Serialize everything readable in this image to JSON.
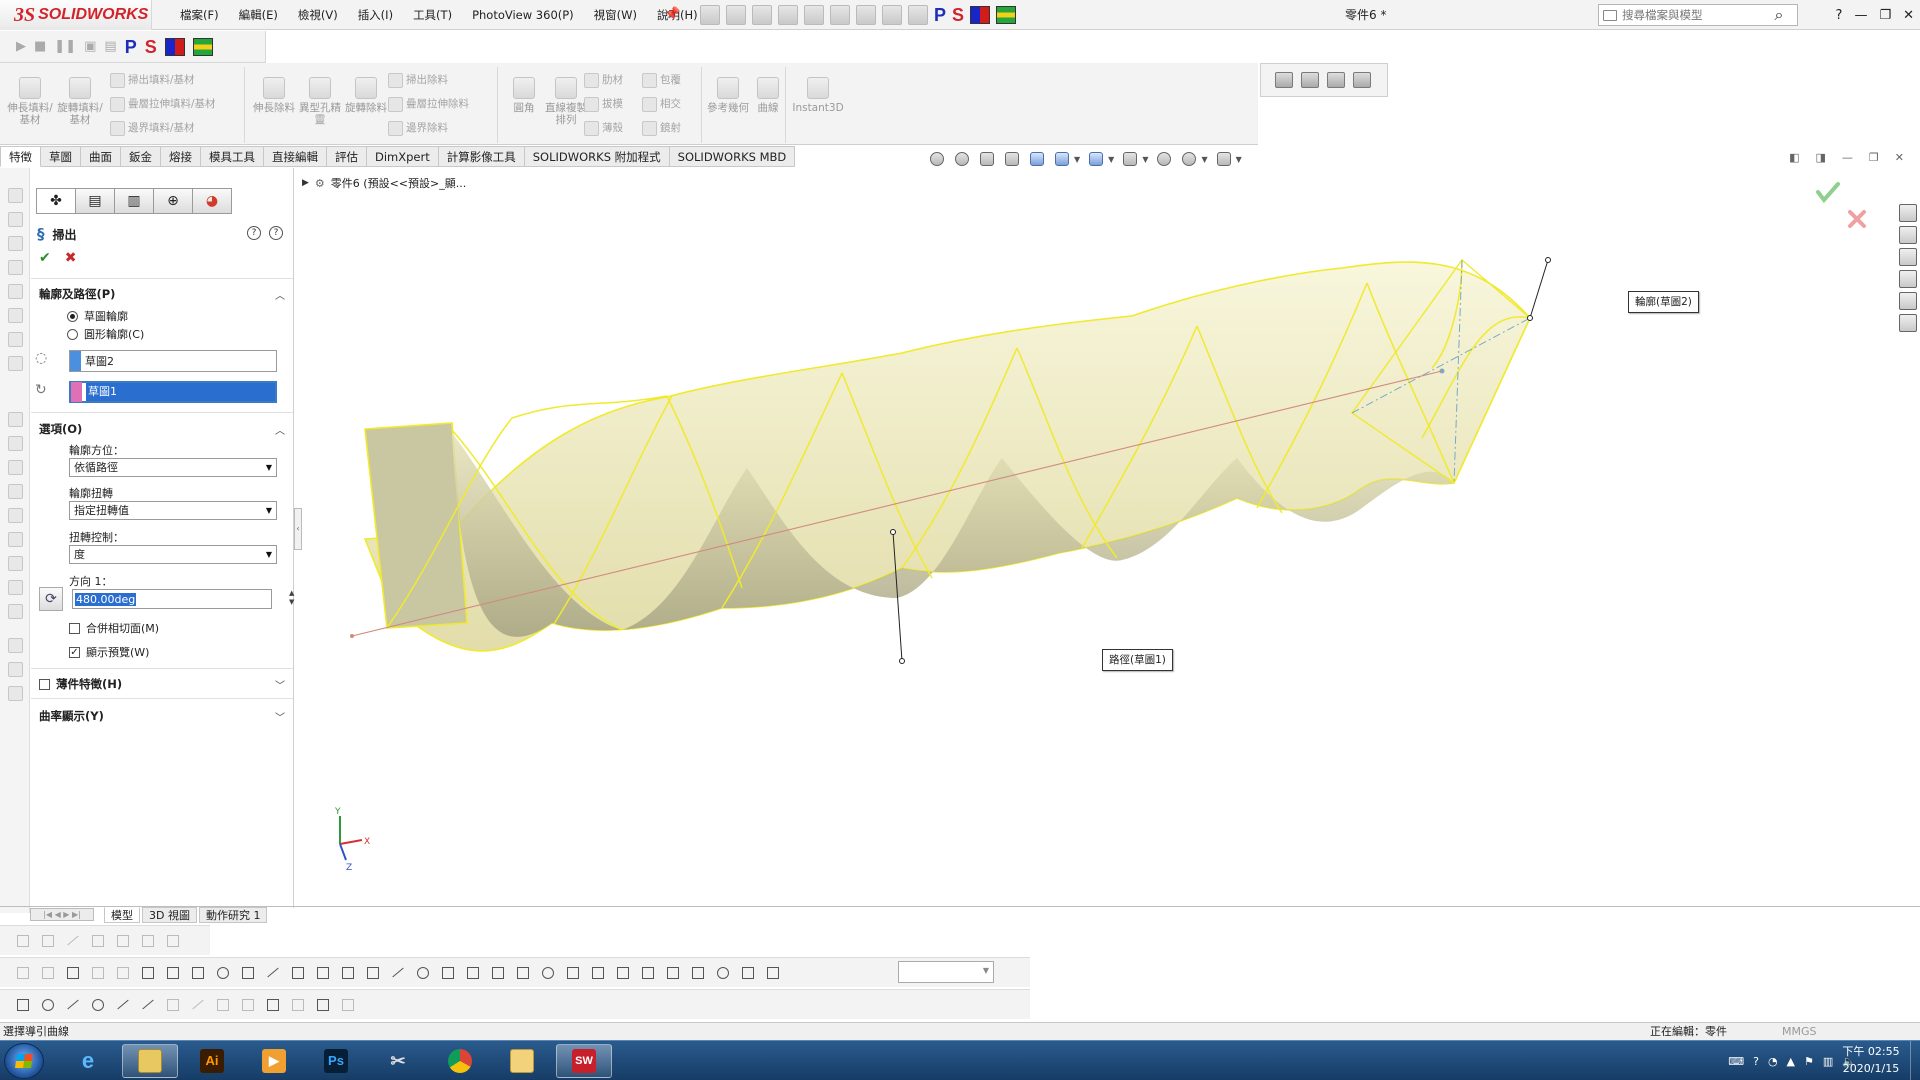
{
  "app": {
    "brand_ds": "3S",
    "brand_name": "SOLIDWORKS",
    "doc_title": "零件6 *",
    "search_placeholder": "搜尋檔案與模型"
  },
  "menus": [
    "檔案(F)",
    "編輯(E)",
    "檢視(V)",
    "插入(I)",
    "工具(T)",
    "PhotoView 360(P)",
    "視窗(W)",
    "說明(H)"
  ],
  "addin_letters": [
    "P",
    "S"
  ],
  "ribbon": {
    "big": [
      {
        "label": "伸長填料/基材"
      },
      {
        "label": "旋轉填料/基材"
      },
      {
        "label": "伸長除料"
      },
      {
        "label": "異型孔精靈"
      },
      {
        "label": "旋轉除料"
      },
      {
        "label": "圓角"
      },
      {
        "label": "直線複製排列"
      },
      {
        "label": "參考幾何"
      },
      {
        "label": "曲線"
      },
      {
        "label": "Instant3D"
      }
    ],
    "small": [
      {
        "label": "掃出填料/基材"
      },
      {
        "label": "疊層拉伸填料/基材"
      },
      {
        "label": "邊界填料/基材"
      },
      {
        "label": "掃出除料"
      },
      {
        "label": "疊層拉伸除料"
      },
      {
        "label": "邊界除料"
      },
      {
        "label": "肋材"
      },
      {
        "label": "包覆"
      },
      {
        "label": "拔模"
      },
      {
        "label": "相交"
      },
      {
        "label": "薄殼"
      },
      {
        "label": "鏡射"
      }
    ]
  },
  "tabs": [
    "特徵",
    "草圖",
    "曲面",
    "鈑金",
    "熔接",
    "模具工具",
    "直接編輯",
    "評估",
    "DimXpert",
    "計算影像工具",
    "SOLIDWORKS 附加程式",
    "SOLIDWORKS MBD"
  ],
  "active_tab": "特徵",
  "tree_crumb": "零件6 (預設<<預設>_顯...",
  "pm": {
    "title": "掃出",
    "ok": "✔",
    "cancel": "✖",
    "section1_title": "輪廓及路徑(P)",
    "radio_sketch": "草圖輪廓",
    "radio_circle": "圓形輪廓(C)",
    "profile_value": "草圖2",
    "path_value": "草圖1",
    "section2_title": "選項(O)",
    "orient_label": "輪廓方位：",
    "orient_value": "依循路徑",
    "twist_label": "輪廓扭轉",
    "twist_value": "指定扭轉值",
    "twistctl_label": "扭轉控制：",
    "twistctl_value": "度",
    "dir_label": "方向 1：",
    "dir_value": "480.00deg",
    "merge_tangent": "合併相切面(M)",
    "show_preview": "顯示預覽(W)",
    "section3_title": "薄件特徵(H)",
    "section4_title": "曲率顯示(Y)"
  },
  "callouts": {
    "profile": "輪廓(草圖2)",
    "path": "路徑(草圖1)"
  },
  "axes": {
    "y": "Y",
    "x": "X",
    "z": "Z"
  },
  "model_tabs": [
    "模型",
    "3D 視圖",
    "動作研究 1"
  ],
  "status": {
    "left": "選擇導引曲線",
    "editing": "正在編輯：零件",
    "units": "MMGS"
  },
  "taskbar": {
    "apps": [
      "IE",
      "Explorer",
      "Ai",
      "Media",
      "Ps",
      "Tool",
      "Chrome",
      "Folder",
      "SW 2016"
    ],
    "time": "下午 02:55",
    "date": "2020/1/15"
  },
  "colors": {
    "accent": "#d2232a",
    "selection": "#2a6fd0",
    "sweep_face": "#eeeab4",
    "sweep_edge": "#f0ea2e",
    "path_line": "#d08a80"
  }
}
